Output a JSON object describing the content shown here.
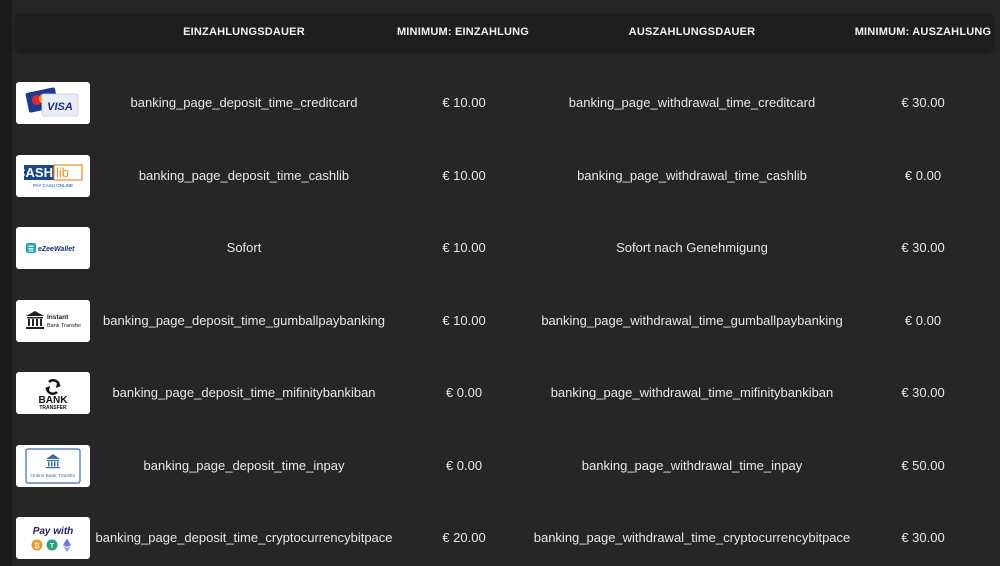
{
  "header": {
    "deposit_time": "EINZAHLUNGSDAUER",
    "min_deposit": "MINIMUM: EINZAHLUNG",
    "withdrawal_time": "AUSZAHLUNGSDAUER",
    "min_withdrawal": "MINIMUM: AUSZAHLUNG"
  },
  "rows": [
    {
      "logo": {
        "icon": "visa-mastercard-card-icon",
        "text": "VISA"
      },
      "deposit_time": "banking_page_deposit_time_creditcard",
      "min_deposit": "€ 10.00",
      "withdrawal_time": "banking_page_withdrawal_time_creditcard",
      "min_withdrawal": "€ 30.00"
    },
    {
      "logo": {
        "icon": "cashlib-logo",
        "text": "CASHlib",
        "sub": "PAY CASH ONLINE"
      },
      "deposit_time": "banking_page_deposit_time_cashlib",
      "min_deposit": "€ 10.00",
      "withdrawal_time": "banking_page_withdrawal_time_cashlib",
      "min_withdrawal": "€ 0.00"
    },
    {
      "logo": {
        "icon": "ezeewallet-logo",
        "text": "eZeeWallet"
      },
      "deposit_time": "Sofort",
      "min_deposit": "€ 10.00",
      "withdrawal_time": "Sofort nach Genehmigung",
      "min_withdrawal": "€ 30.00"
    },
    {
      "logo": {
        "icon": "bank-building-icon",
        "text": "Instant",
        "sub": "Bank Transfer"
      },
      "deposit_time": "banking_page_deposit_time_gumballpaybanking",
      "min_deposit": "€ 10.00",
      "withdrawal_time": "banking_page_withdrawal_time_gumballpaybanking",
      "min_withdrawal": "€ 0.00"
    },
    {
      "logo": {
        "icon": "bank-transfer-arrows-icon",
        "text": "BANK",
        "sub": "TRANSFER"
      },
      "deposit_time": "banking_page_deposit_time_mifinitybankiban",
      "min_deposit": "€ 0.00",
      "withdrawal_time": "banking_page_withdrawal_time_mifinitybankiban",
      "min_withdrawal": "€ 30.00"
    },
    {
      "logo": {
        "icon": "online-bank-transfer-icon",
        "text": "Online Bank Transfer"
      },
      "deposit_time": "banking_page_deposit_time_inpay",
      "min_deposit": "€ 0.00",
      "withdrawal_time": "banking_page_withdrawal_time_inpay",
      "min_withdrawal": "€ 50.00"
    },
    {
      "logo": {
        "icon": "crypto-coins-icon",
        "text": "Pay with"
      },
      "deposit_time": "banking_page_deposit_time_cryptocurrencybitpace",
      "min_deposit": "€ 20.00",
      "withdrawal_time": "banking_page_withdrawal_time_cryptocurrencybitpace",
      "min_withdrawal": "€ 30.00"
    }
  ]
}
